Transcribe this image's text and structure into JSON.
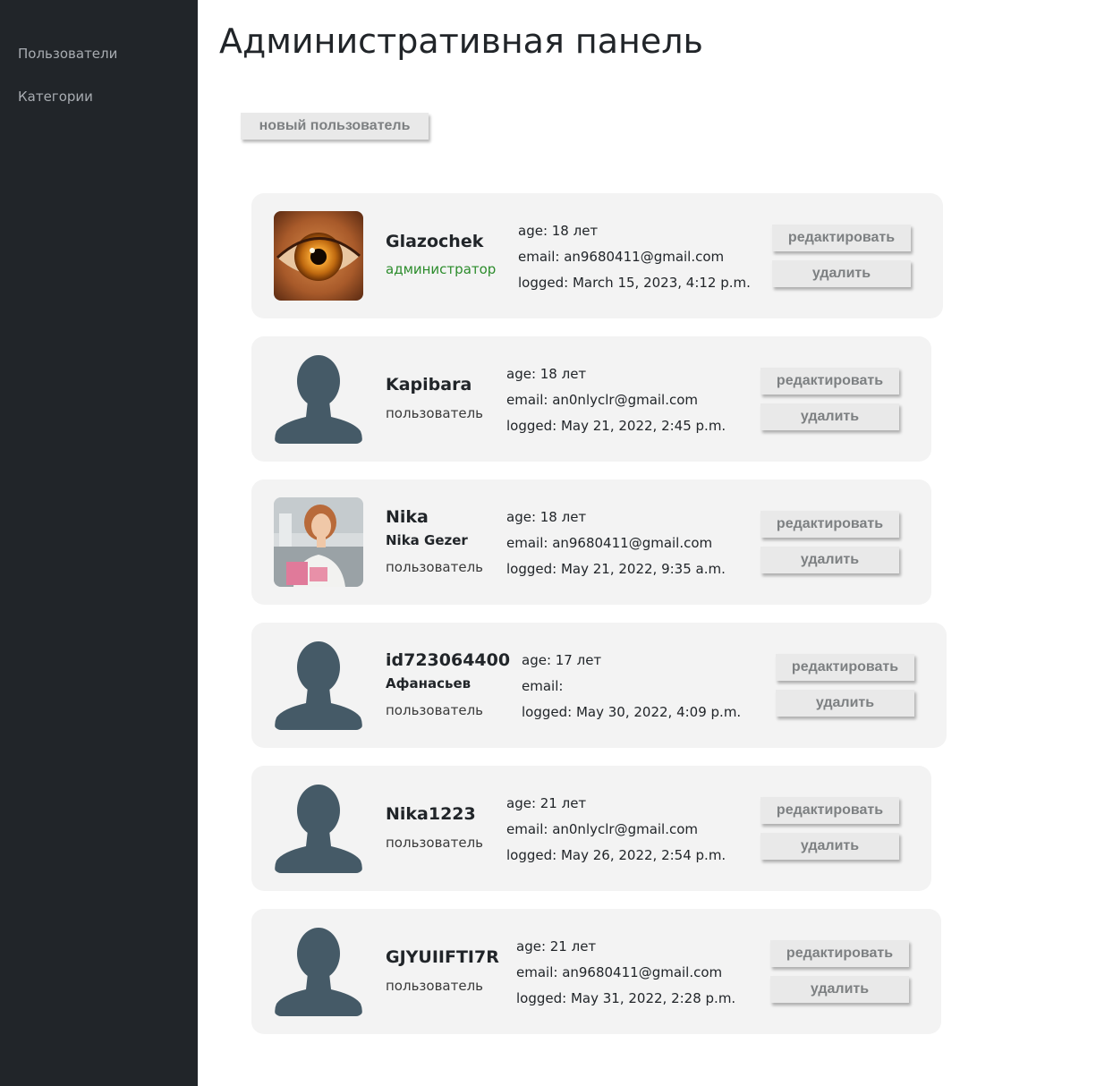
{
  "sidebar": {
    "items": [
      {
        "label": "Пользователи"
      },
      {
        "label": "Категории"
      }
    ]
  },
  "page": {
    "title": "Административная панель",
    "new_user_label": "новый пользователь"
  },
  "actions": {
    "edit_label": "редактировать",
    "delete_label": "удалить"
  },
  "users": [
    {
      "username": "Glazochek",
      "full_name": "",
      "role": "администратор",
      "role_is_admin": true,
      "avatar": "eye-photo",
      "age": "age: 18 лет",
      "email": "email: an9680411@gmail.com",
      "logged": "logged: March 15, 2023, 4:12 p.m."
    },
    {
      "username": "Kapibara",
      "full_name": "",
      "role": "пользователь",
      "avatar": "default-silhouette",
      "age": "age: 18 лет",
      "email": "email: an0nlyclr@gmail.com",
      "logged": "logged: May 21, 2022, 2:45 p.m."
    },
    {
      "username": "Nika",
      "full_name": "Nika Gezer",
      "role": "пользователь",
      "avatar": "person-photo",
      "age": "age: 18 лет",
      "email": "email: an9680411@gmail.com",
      "logged": "logged: May 21, 2022, 9:35 a.m."
    },
    {
      "username": "id723064400",
      "full_name": "Афанасьев",
      "role": "пользователь",
      "avatar": "default-silhouette",
      "age": "age: 17 лет",
      "email": "email:",
      "logged": "logged: May 30, 2022, 4:09 p.m."
    },
    {
      "username": "Nika1223",
      "full_name": "",
      "role": "пользователь",
      "avatar": "default-silhouette",
      "age": "age: 21 лет",
      "email": "email: an0nlyclr@gmail.com",
      "logged": "logged: May 26, 2022, 2:54 p.m."
    },
    {
      "username": "GJYUIIFTI7R",
      "full_name": "",
      "role": "пользователь",
      "avatar": "default-silhouette",
      "age": "age: 21 лет",
      "email": "email: an9680411@gmail.com",
      "logged": "logged: May 31, 2022, 2:28 p.m."
    }
  ],
  "colors": {
    "sidebar_bg": "#212529",
    "card_bg": "#f3f3f3",
    "admin_role": "#2c8c2c",
    "silhouette": "#455a67"
  }
}
